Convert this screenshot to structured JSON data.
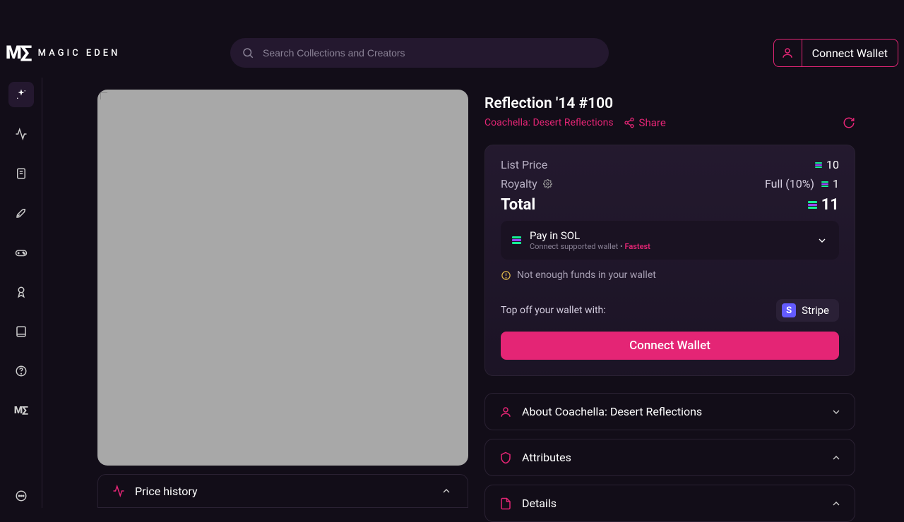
{
  "brand": {
    "mark": "M∑",
    "text": "MAGIC EDEN"
  },
  "search": {
    "placeholder": "Search Collections and Creators"
  },
  "header": {
    "connect_label": "Connect Wallet"
  },
  "nft": {
    "title": "Reflection '14 #100",
    "collection": "Coachella: Desert Reflections",
    "share_label": "Share"
  },
  "pricing": {
    "list_label": "List Price",
    "list_value": "10",
    "royalty_label": "Royalty",
    "royalty_desc": "Full (10%)",
    "royalty_value": "1",
    "total_label": "Total",
    "total_value": "11"
  },
  "payment": {
    "title": "Pay in SOL",
    "subtitle_pre": "Connect supported wallet",
    "subtitle_fast": "Fastest",
    "warn": "Not enough funds in your wallet",
    "topoff_label": "Top off your wallet with:",
    "stripe_label": "Stripe",
    "connect_label": "Connect Wallet"
  },
  "accordions": {
    "about": "About Coachella: Desert Reflections",
    "attributes": "Attributes",
    "details": "Details"
  },
  "left": {
    "price_history": "Price history"
  }
}
